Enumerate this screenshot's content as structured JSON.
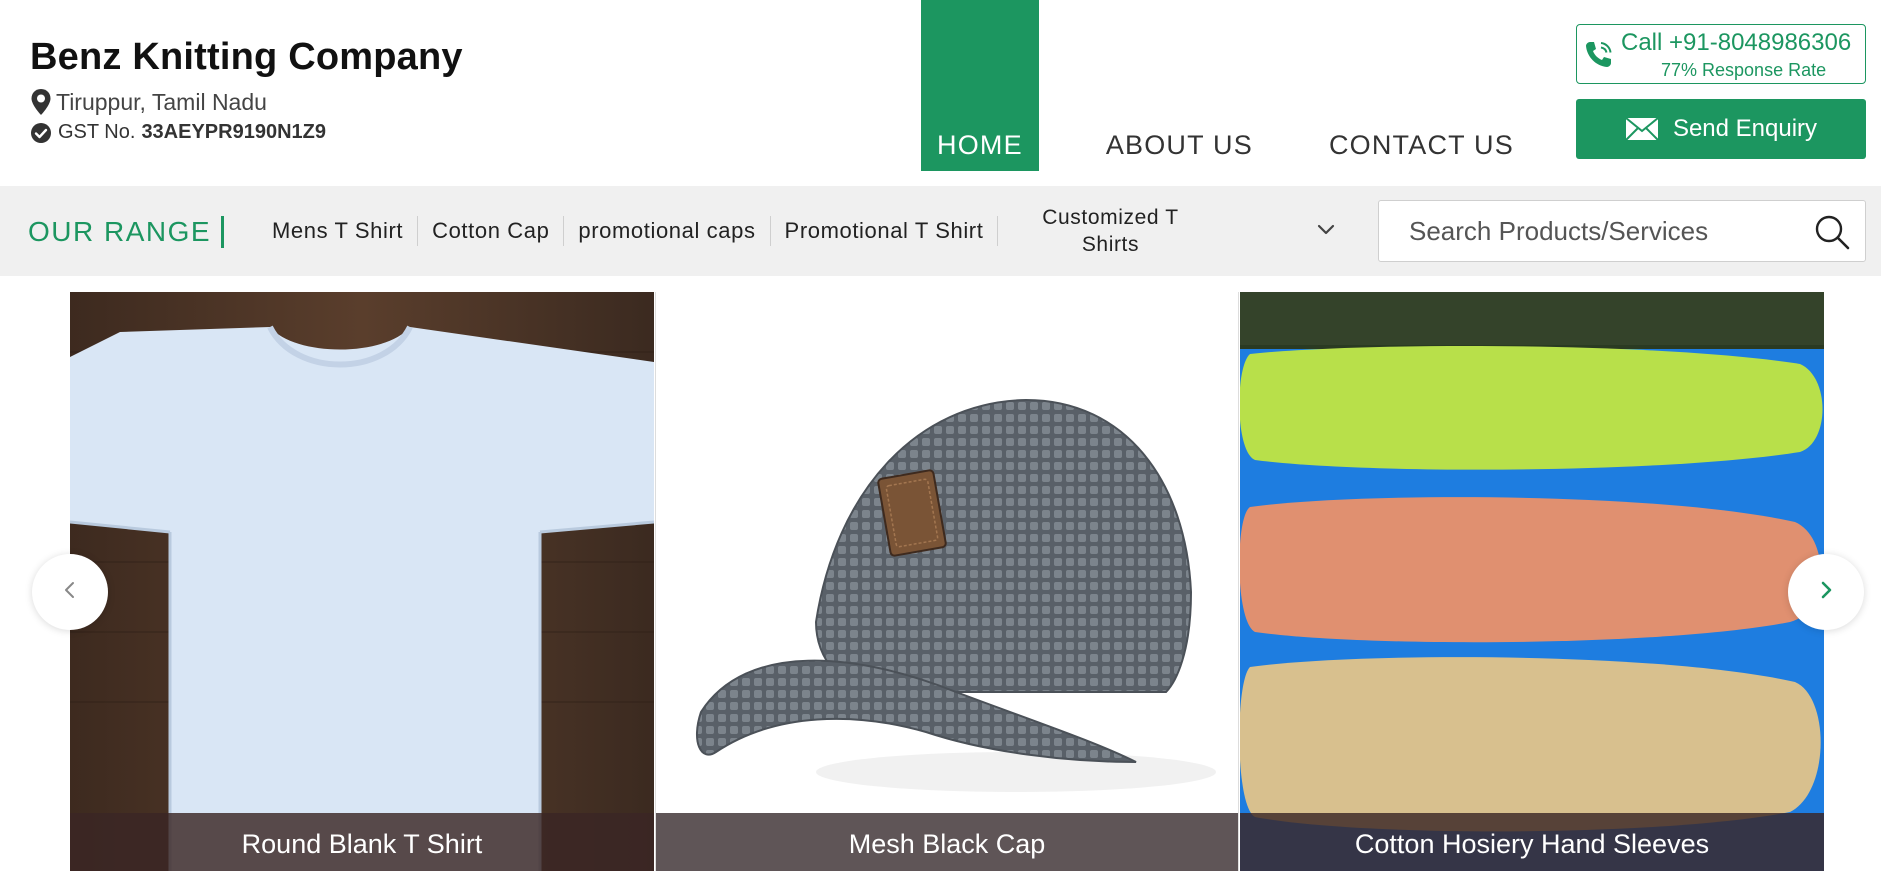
{
  "header": {
    "company_name": "Benz Knitting Company",
    "location": "Tiruppur, Tamil Nadu",
    "gst_label": "GST No.",
    "gst_number": "33AEYPR9190N1Z9"
  },
  "nav": {
    "items": [
      {
        "label": "HOME",
        "active": true
      },
      {
        "label": "ABOUT US",
        "active": false
      },
      {
        "label": "CONTACT US",
        "active": false
      }
    ]
  },
  "contact": {
    "phone": "Call +91-8048986306",
    "response_rate": "77% Response Rate",
    "enquiry_label": "Send Enquiry"
  },
  "range": {
    "title": "OUR RANGE",
    "links": [
      "Mens T Shirt",
      "Cotton Cap",
      "promotional caps",
      "Promotional T Shirt",
      "Customized T Shirts"
    ]
  },
  "search": {
    "placeholder": "Search Products/Services"
  },
  "products": [
    {
      "name": "Round Blank T Shirt"
    },
    {
      "name": "Mesh Black Cap"
    },
    {
      "name": "Cotton Hosiery Hand Sleeves"
    }
  ],
  "colors": {
    "brand_green": "#1c9660",
    "range_bar_bg": "#f0f0f0",
    "caption_bg": "#3a2624"
  },
  "icons": {
    "location": "map-pin-icon",
    "verified": "check-circle-icon",
    "phone": "phone-icon",
    "enquiry": "envelope-icon",
    "dropdown": "chevron-down-icon",
    "search": "search-icon",
    "prev": "chevron-left-icon",
    "next": "chevron-right-icon"
  }
}
